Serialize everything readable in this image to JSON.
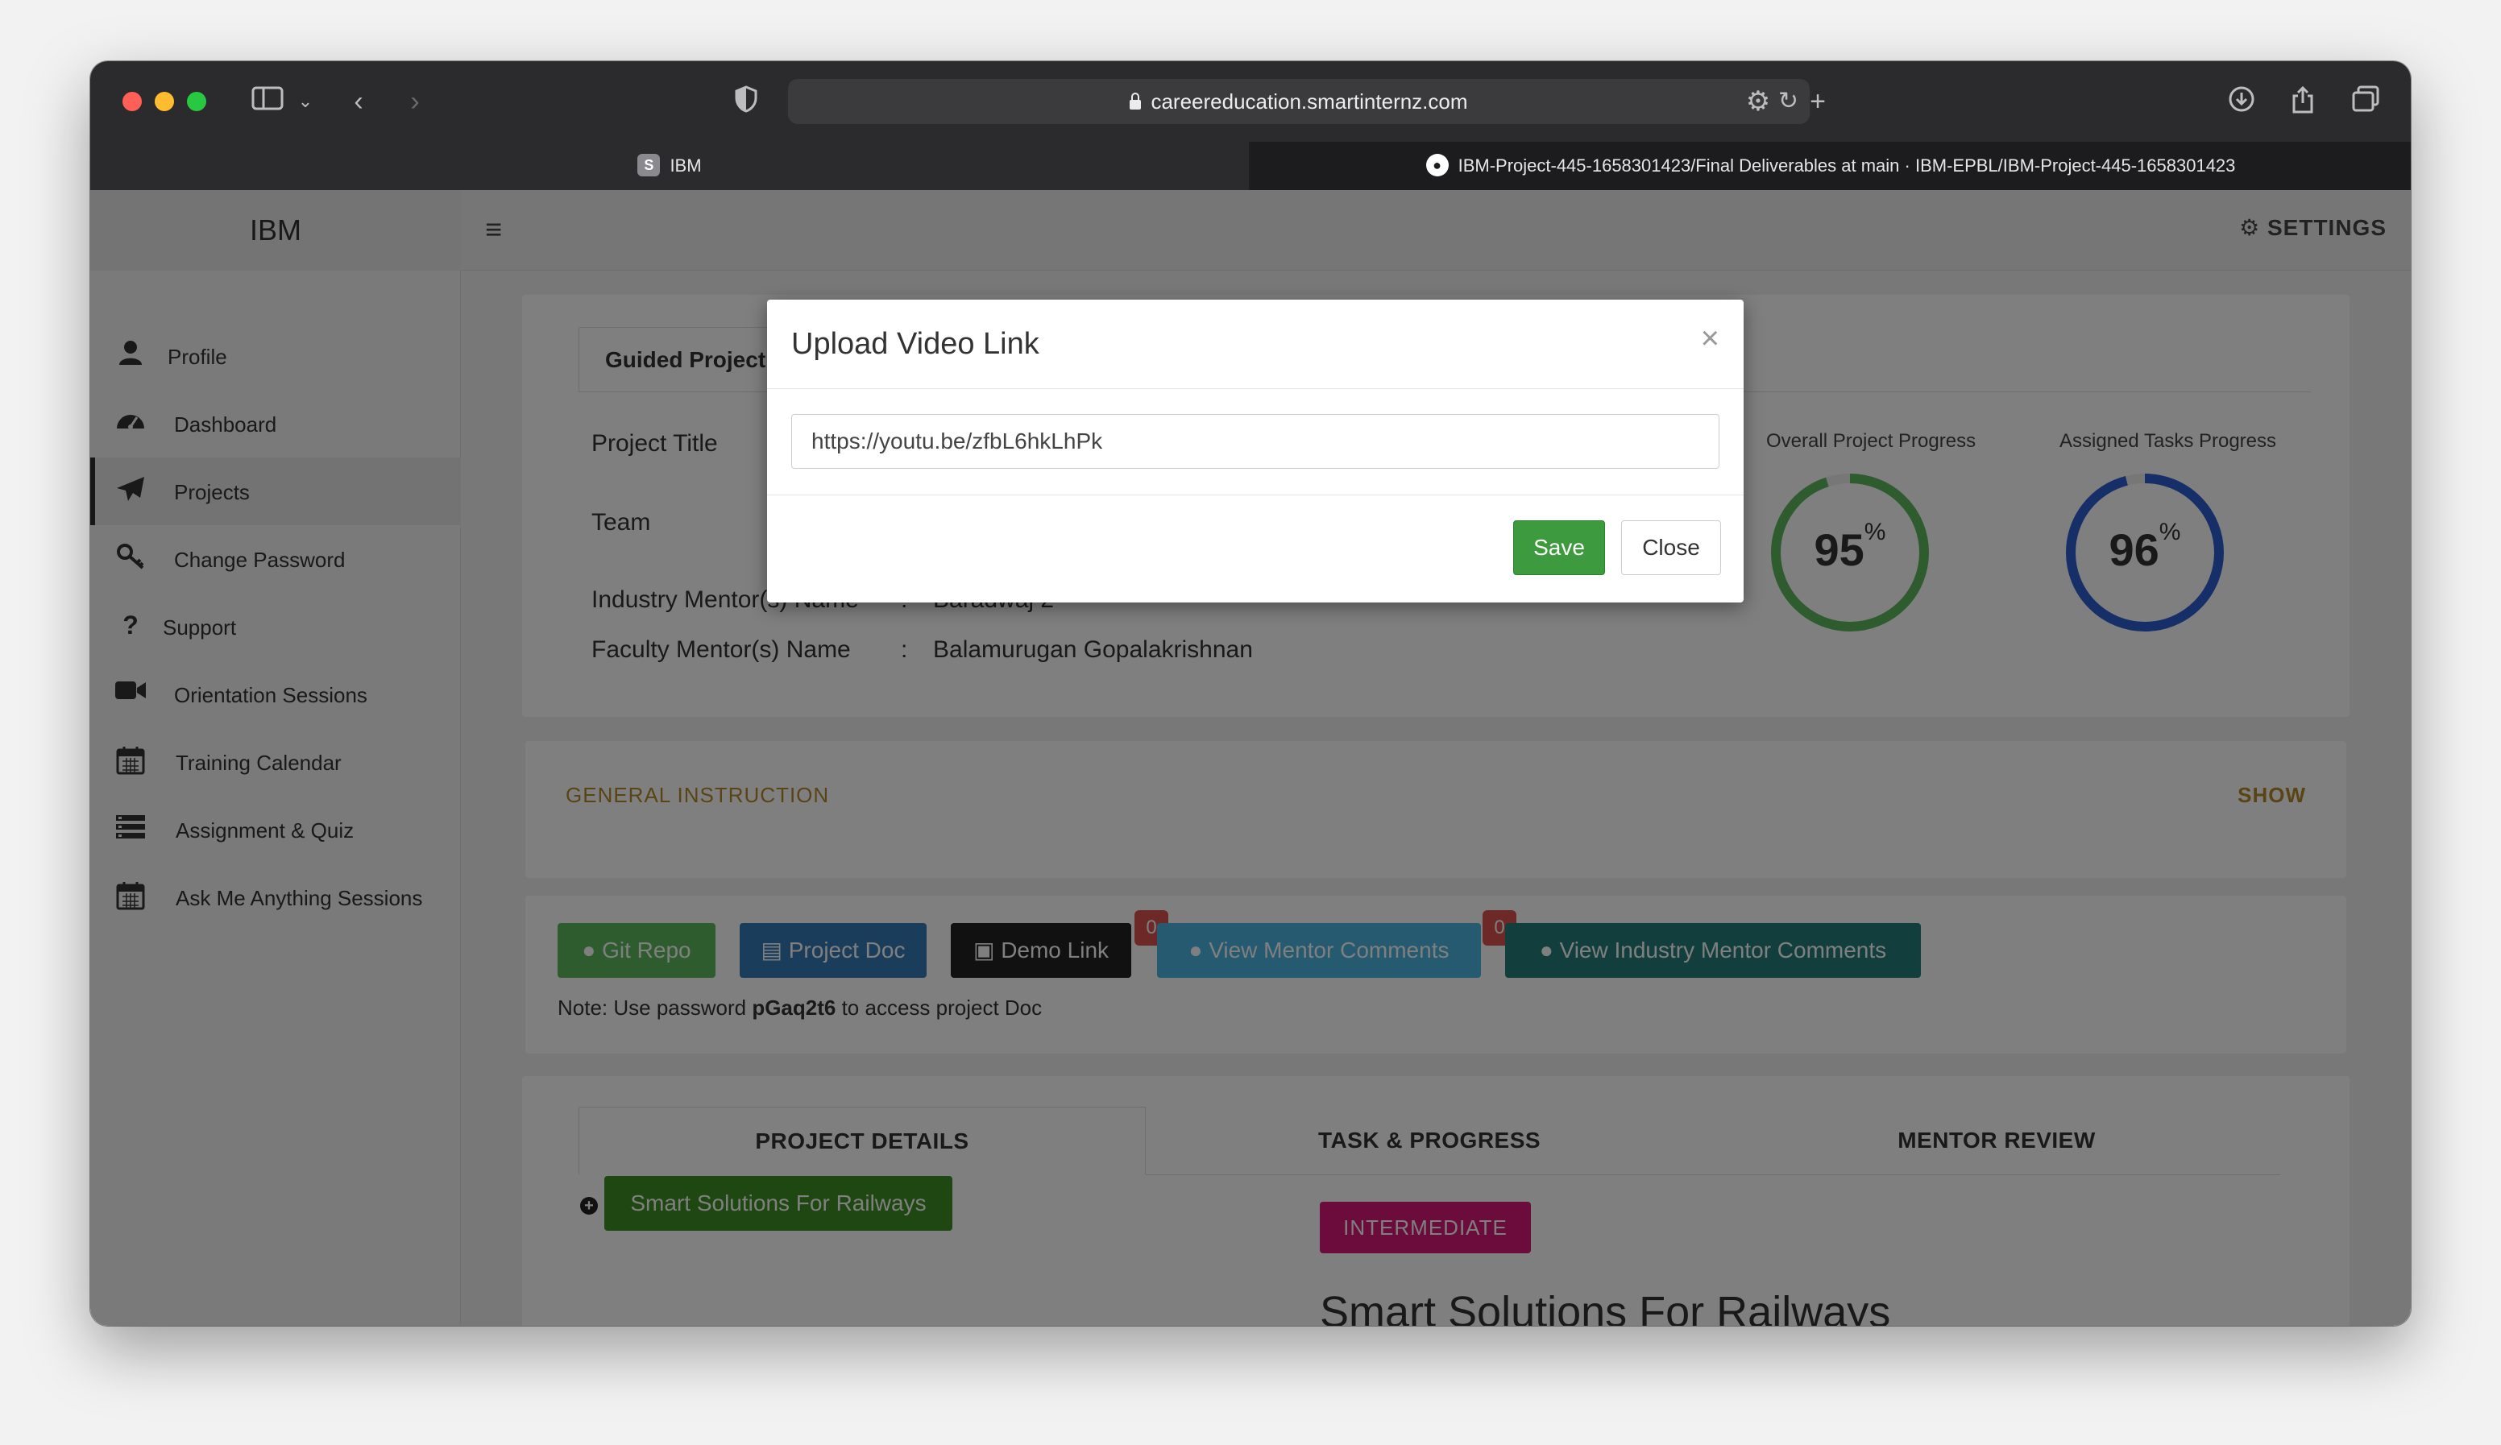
{
  "browser": {
    "url": "careereducation.smartinternz.com",
    "tabs": [
      {
        "favicon": "S",
        "label": "IBM"
      },
      {
        "favicon": "github-icon",
        "label": "IBM-Project-445-1658301423/Final Deliverables at main · IBM-EPBL/IBM-Project-445-1658301423"
      }
    ]
  },
  "app": {
    "brand": "IBM",
    "settings_label": "SETTINGS",
    "sidebar": [
      {
        "icon": "user-icon",
        "label": "Profile",
        "active": false
      },
      {
        "icon": "dashboard-icon",
        "label": "Dashboard",
        "active": false
      },
      {
        "icon": "paper-plane-icon",
        "label": "Projects",
        "active": true
      },
      {
        "icon": "key-icon",
        "label": "Change Password",
        "active": false
      },
      {
        "icon": "question-icon",
        "label": "Support",
        "active": false
      },
      {
        "icon": "video-camera-icon",
        "label": "Orientation Sessions",
        "active": false
      },
      {
        "icon": "calendar-icon",
        "label": "Training Calendar",
        "active": false
      },
      {
        "icon": "list-icon",
        "label": "Assignment & Quiz",
        "active": false
      },
      {
        "icon": "calendar-icon",
        "label": "Ask Me Anything Sessions",
        "active": false
      }
    ]
  },
  "project": {
    "tab_label": "Guided Project",
    "fields": {
      "title_label": "Project Title",
      "team_label": "Team",
      "colon": ":",
      "industry_mentor_label": "Industry Mentor(s) Name",
      "industry_mentor_value": "Baradwaj 2",
      "faculty_mentor_label": "Faculty Mentor(s) Name",
      "faculty_mentor_value": "Balamurugan Gopalakrishnan"
    },
    "progress": {
      "overall_label": "Overall Project Progress",
      "overall_value": 95,
      "overall_display": "95",
      "assigned_label": "Assigned Tasks Progress",
      "assigned_value": 96,
      "assigned_display": "96",
      "unit": "%"
    }
  },
  "general_instruction": {
    "title": "GENERAL INSTRUCTION",
    "toggle": "SHOW"
  },
  "actions": {
    "git_repo": "Git Repo",
    "project_doc": "Project Doc",
    "demo_link": "Demo Link",
    "view_mentor_comments": "View Mentor Comments",
    "mentor_comments_count": "0",
    "view_industry_mentor_comments": "View Industry Mentor Comments",
    "industry_comments_count": "0",
    "note_prefix": "Note: Use password ",
    "note_password": "pGaq2t6",
    "note_suffix": " to access project Doc"
  },
  "details": {
    "tabs": [
      "PROJECT DETAILS",
      "TASK & PROGRESS",
      "MENTOR REVIEW"
    ],
    "project_tag": "Smart Solutions For Railways",
    "level": "INTERMEDIATE",
    "heading": "Smart Solutions For Railways"
  },
  "modal": {
    "title": "Upload Video Link",
    "close_glyph": "×",
    "input_value": "https://youtu.be/zfbL6hkLhPk",
    "save_label": "Save",
    "close_label": "Close"
  },
  "colors": {
    "overall_ring": "#5cb85c",
    "assigned_ring": "#2f5fd0",
    "avatar": "#c9a227"
  }
}
